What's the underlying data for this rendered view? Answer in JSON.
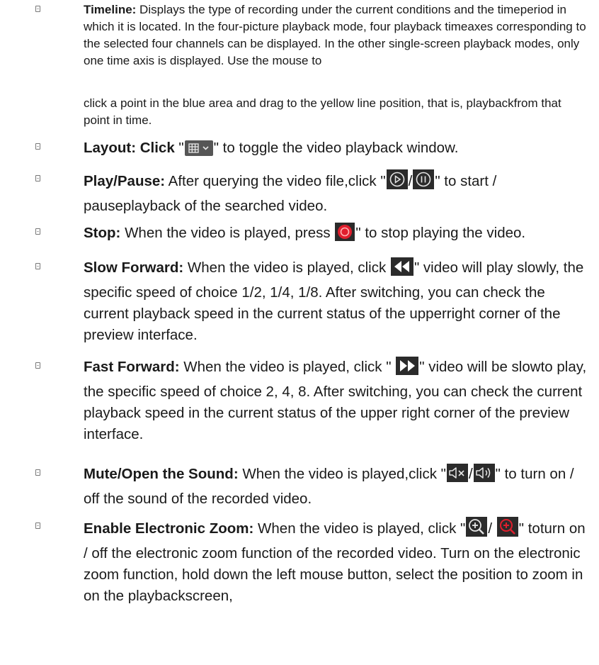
{
  "doc": {
    "timeline": {
      "term": "Timeline:",
      "text": " Displays the type of recording under the current conditions and the timeperiod in which it is located. In the four-picture playback mode, four playback timeaxes corresponding to the selected four channels can be displayed. In the other single-screen playback modes, only one time axis is displayed. Use the mouse to",
      "continuation": "click a point in the blue area and drag to the yellow line position, that is, playbackfrom that point in time."
    },
    "layout": {
      "term": "Layout: Click",
      "before": " \"",
      "icon": "layout-grid-icon",
      "after": "\" to toggle the video playback window."
    },
    "playpause": {
      "term": "Play/Pause:",
      "before": " After querying the video file,click \"",
      "icon1": "play-icon",
      "sep": "/",
      "icon2": "pause-icon",
      "after": "\" to start / pauseplayback of the searched video."
    },
    "stop": {
      "term": "Stop:",
      "before": " When the video is played, press ",
      "icon": "stop-icon",
      "after": "\" to stop playing the video."
    },
    "slow": {
      "term": "Slow Forward:",
      "before": " When the video is played, click ",
      "icon": "slow-forward-icon",
      "after": "\" video will play slowly, the specific speed of choice 1/2, 1/4, 1/8. After switching, you can check the current playback speed in the current status of the upperright corner of the preview interface."
    },
    "fast": {
      "term": "Fast Forward:",
      "before": " When the video is played, click \" ",
      "icon": "fast-forward-icon",
      "after": "\" video will be slowto play, the specific speed of choice 2, 4, 8. After switching, you can check the current playback speed in the current status of the upper right corner of the preview interface."
    },
    "mute": {
      "term": "Mute/Open the Sound:",
      "before": " When the video is played,click \"",
      "icon1": "mute-icon",
      "sep": "/",
      "icon2": "sound-on-icon",
      "after": "\" to turn on / off the sound of the recorded video."
    },
    "zoom": {
      "term": "Enable Electronic Zoom:",
      "before": " When the video is played, click \"",
      "icon1": "zoom-in-icon",
      "sep": "/ ",
      "icon2": "zoom-active-icon",
      "after": "\" toturn on / off the electronic zoom function of the recorded video. Turn on the electronic zoom function, hold down the left mouse button, select the position to zoom in on the playbackscreen,"
    }
  }
}
